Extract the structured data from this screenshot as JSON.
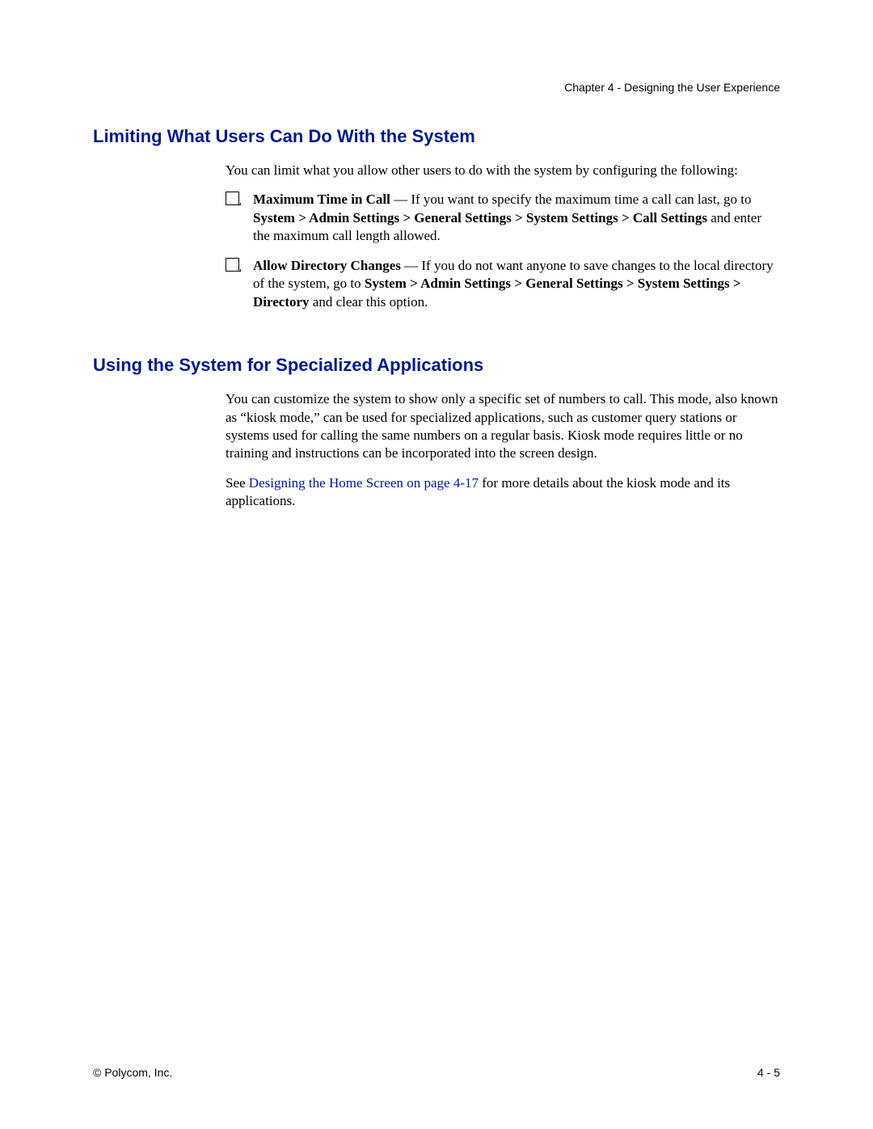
{
  "header": {
    "chapter": "Chapter 4 - Designing the User Experience"
  },
  "section1": {
    "heading": "Limiting What Users Can Do With the System",
    "intro": "You can limit what you allow other users to do with the system by configuring the following:",
    "items": [
      {
        "label": "Maximum Time in Call",
        "sep": " — ",
        "text1": "If you want to specify the maximum time a call can last, go to ",
        "path": "System > Admin Settings > General Settings > System Settings > Call Settings",
        "text2": " and enter the maximum call length allowed."
      },
      {
        "label": "Allow Directory Changes",
        "sep": " — ",
        "text1": "If you do not want anyone to save changes to the local directory of the system, go to ",
        "path": "System > Admin Settings > General Settings > System Settings > Directory",
        "text2": " and clear this option."
      }
    ]
  },
  "section2": {
    "heading": "Using the System for Specialized Applications",
    "para1": "You can customize the system to show only a specific set of numbers to call. This mode, also known as “kiosk mode,” can be used for specialized applications, such as customer query stations or systems used for calling the same numbers on a regular basis. Kiosk mode requires little or no training and instructions can be incorporated into the screen design.",
    "para2_pre": "See ",
    "para2_link": "Designing the Home Screen on page 4-17",
    "para2_post": " for more details about the kiosk mode and its applications."
  },
  "footer": {
    "left": "© Polycom, Inc.",
    "right": "4 - 5"
  }
}
